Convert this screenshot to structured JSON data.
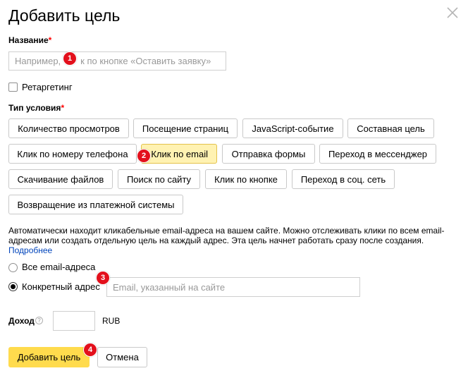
{
  "dialog": {
    "title": "Добавить цель",
    "close_icon": "close-icon"
  },
  "name_field": {
    "label": "Название",
    "required_mark": "*",
    "placeholder": "Например, клик по кнопке «Оставить заявку»",
    "visible_placeholder_left": "Например,",
    "visible_placeholder_right": "к по кнопке «Оставить заявку»"
  },
  "retargeting": {
    "label": "Ретаргетинг",
    "checked": false
  },
  "condition_type": {
    "label": "Тип условия",
    "required_mark": "*",
    "options": [
      {
        "label": "Количество просмотров",
        "active": false
      },
      {
        "label": "Посещение страниц",
        "active": false
      },
      {
        "label": "JavaScript-событие",
        "active": false
      },
      {
        "label": "Составная цель",
        "active": false
      },
      {
        "label": "Клик по номеру телефона",
        "active": false
      },
      {
        "label": "Клик по email",
        "active": true
      },
      {
        "label": "Отправка формы",
        "active": false
      },
      {
        "label": "Переход в мессенджер",
        "active": false
      },
      {
        "label": "Скачивание файлов",
        "active": false
      },
      {
        "label": "Поиск по сайту",
        "active": false
      },
      {
        "label": "Клик по кнопке",
        "active": false
      },
      {
        "label": "Переход в соц. сеть",
        "active": false
      },
      {
        "label": "Возвращение из платежной системы",
        "active": false
      }
    ]
  },
  "description": {
    "text": "Автоматически находит кликабельные email-адреса на вашем сайте. Можно отслеживать клики по всем email-адресам или создать отдельную цель на каждый адрес. Эта цель начнет работать сразу после создания.",
    "more_link": "Подробнее"
  },
  "email_scope": {
    "all_label": "Все email-адреса",
    "specific_label": "Конкретный адрес",
    "selected": "specific",
    "email_placeholder": "Email, указанный на сайте"
  },
  "income": {
    "label": "Доход",
    "help_glyph": "?",
    "value": "",
    "currency": "RUB"
  },
  "actions": {
    "submit_label": "Добавить цель",
    "cancel_label": "Отмена"
  },
  "badges": [
    "1",
    "2",
    "3",
    "4"
  ],
  "colors": {
    "primary": "#ffdb4d",
    "active_option": "#fff2b2",
    "required": "#ff0000",
    "link": "#0044bb",
    "badge": "#e3101c"
  }
}
